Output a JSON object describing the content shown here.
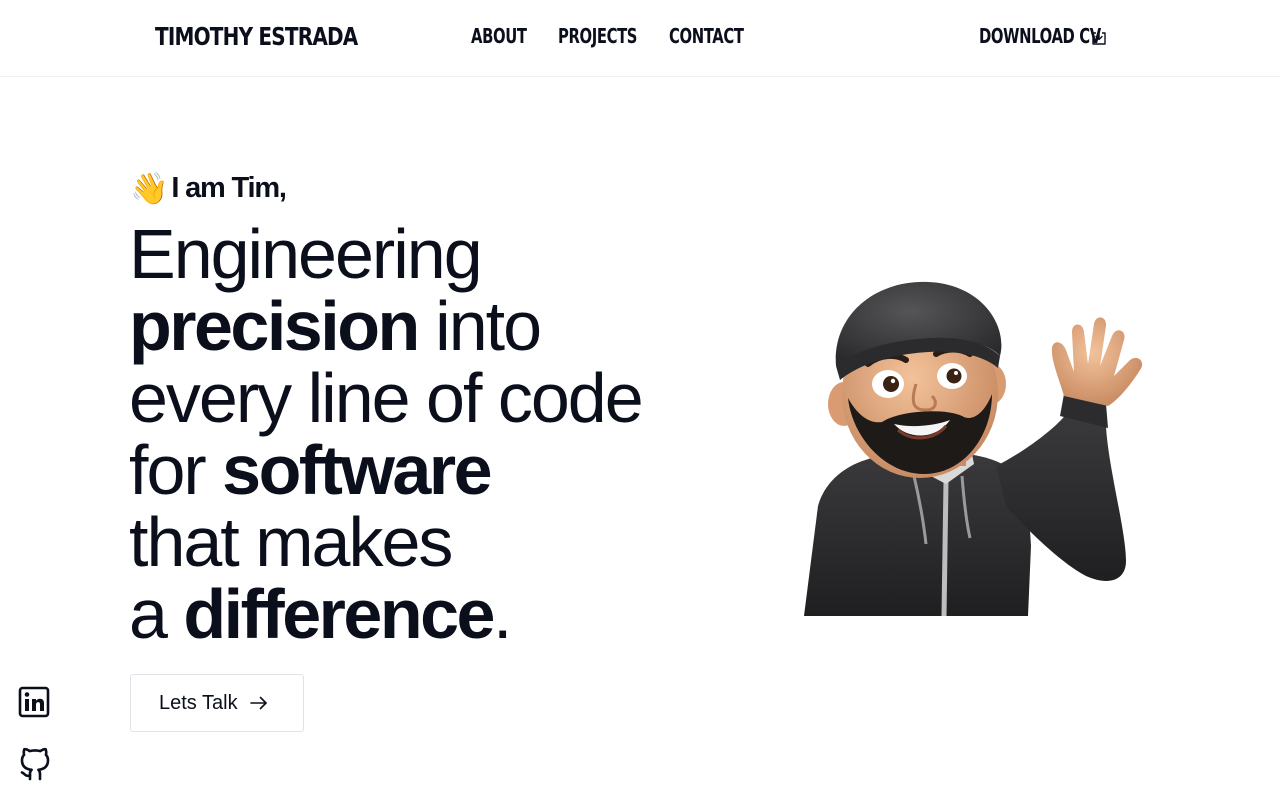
{
  "header": {
    "brand": "TIMOTHY ESTRADA",
    "nav": [
      {
        "label": "ABOUT"
      },
      {
        "label": "PROJECTS"
      },
      {
        "label": "CONTACT"
      }
    ],
    "download_cv": "DOWNLOAD CV",
    "download_icon": "download-icon"
  },
  "hero": {
    "wave_emoji": "👋",
    "greeting": "I am Tim,",
    "headline": {
      "l1": "Engineering",
      "l2_bold": "precision",
      "l2_rest": " into",
      "l3": "every line of code",
      "l4_pre": "for ",
      "l4_bold": "software",
      "l5": "that makes",
      "l6_pre": "a ",
      "l6_bold": "difference",
      "l6_post": "."
    },
    "cta_label": "Lets Talk",
    "cta_icon": "arrow-right-icon"
  },
  "social": [
    {
      "icon": "linkedin-icon"
    },
    {
      "icon": "github-icon"
    }
  ],
  "avatar_icon": "memoji-avatar"
}
